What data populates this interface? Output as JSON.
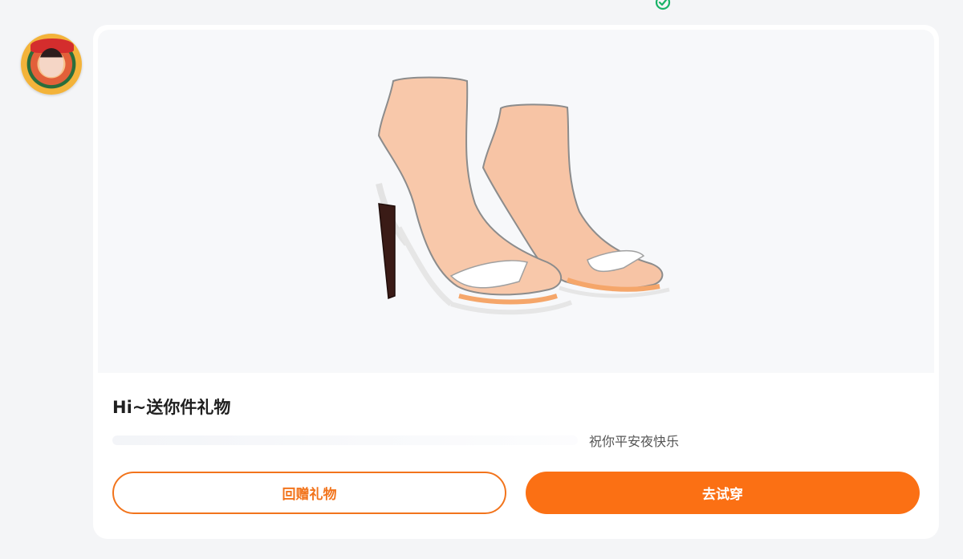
{
  "header": {
    "verified_icon": "check-circle-icon",
    "avatar_icon": "user-avatar"
  },
  "colors": {
    "accent": "#fb7014",
    "card_bg": "#ffffff",
    "page_bg": "#f4f5f7"
  },
  "gift_card": {
    "image_icon": "high-heel-sandals-image",
    "title": "Hi~送你件礼物",
    "message": "祝你平安夜快乐"
  },
  "actions": {
    "return_gift_label": "回赠礼物",
    "try_on_label": "去试穿"
  }
}
